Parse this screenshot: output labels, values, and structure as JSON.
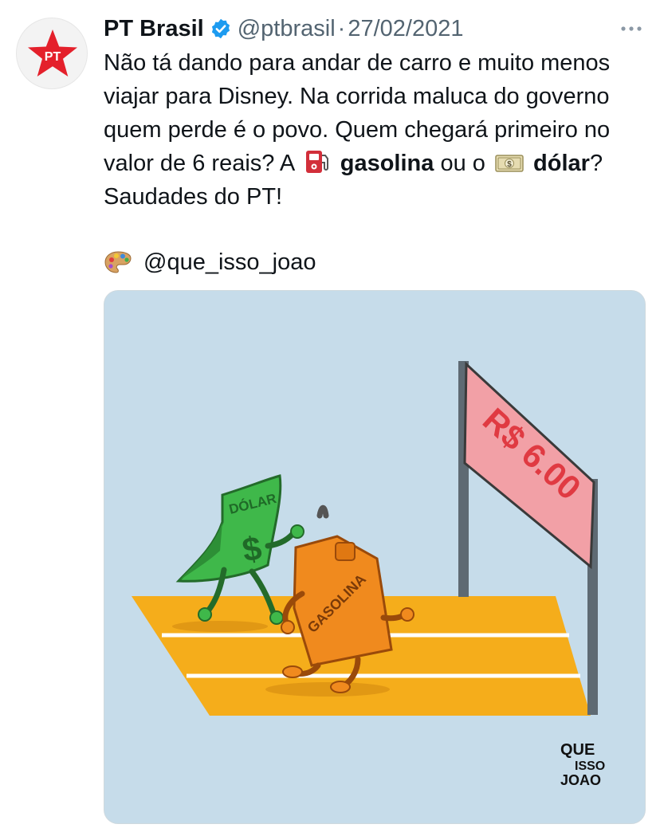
{
  "tweet": {
    "author_name": "PT Brasil",
    "handle": "@ptbrasil",
    "separator": "·",
    "date": "27/02/2021",
    "avatar_text": "PT",
    "text_p1": "Não tá dando para andar de carro e muito menos viajar para Disney. Na corrida maluca do governo quem perde é o povo. Quem chegará primeiro no valor de 6 reais? A",
    "word_gasolina": "gasolina",
    "text_or": "ou o",
    "word_dolar": "dólar",
    "text_end": "? Saudades do PT!",
    "credit_handle": "@que_isso_joao"
  },
  "illustration": {
    "finish_sign": "R$ 6.00",
    "dollar_label": "DÓLAR",
    "dollar_symbol": "$",
    "gas_label": "GASOLINA",
    "artist_line1": "QUE",
    "artist_line2": "ISSO",
    "artist_line3": "JOAO"
  },
  "icons": {
    "verified": "verified-badge-icon",
    "more": "more-options-icon",
    "fuel_pump": "fuel-pump-emoji",
    "dollar_banknote": "dollar-banknote-emoji",
    "palette": "artist-palette-emoji"
  },
  "colors": {
    "verified_blue": "#1d9bf0",
    "pt_red": "#e4202b",
    "secondary_text": "#536471",
    "sky": "#c6dcea",
    "track": "#f5ad1b",
    "dollar_green": "#3fb84a",
    "gas_orange": "#f08a1e"
  }
}
